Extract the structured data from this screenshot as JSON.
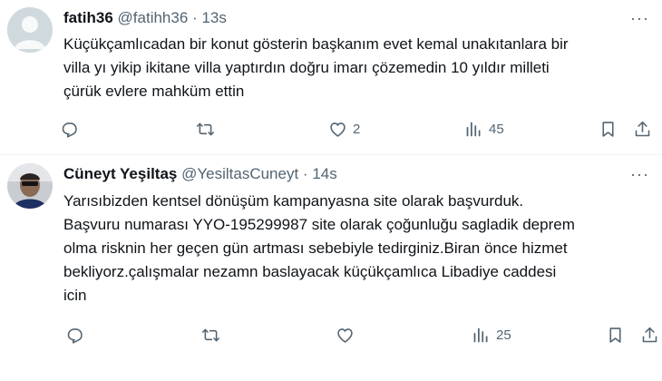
{
  "tweets": [
    {
      "display_name": "fatih36",
      "handle": "@fatihh36",
      "separator": "·",
      "time": "13s",
      "text_lines": [
        "Küçükçamlıcadan bir konut gösterin başkanım  evet kemal  unakıtanlara bir",
        "villa yı yikip ikitane villa yaptırdın doğru imarı çözemedin 10 yıldır  milleti",
        "çürük evlere mahküm ettin"
      ],
      "replies": "",
      "retweets": "",
      "likes": "2",
      "views": "45"
    },
    {
      "display_name": "Cüneyt Yeşiltaş",
      "handle": "@YesiltasCuneyt",
      "separator": "·",
      "time": "14s",
      "text_lines": [
        "Yarısıbizden kentsel dönüşüm kampanyasna site olarak başvurduk.",
        "Başvuru numarası YYO-195299987 site olarak çoğunluğu sagladik deprem",
        "olma risknin her geçen gün artması sebebiyle tedirginiz.Biran önce hizmet",
        "bekliyorz.çalışmalar nezamn baslayacak küçükçamlıca Libadiye caddesi",
        "icin"
      ],
      "replies": "",
      "retweets": "",
      "likes": "",
      "views": "25"
    }
  ],
  "more_glyph": "···",
  "icons": [
    "reply-icon",
    "retweet-icon",
    "like-icon",
    "views-icon",
    "bookmark-icon",
    "share-icon",
    "more-icon"
  ],
  "colors": {
    "text": "#0f1419",
    "secondary": "#536471",
    "divider": "#eff3f4",
    "avatar_placeholder": "#cfd9de"
  }
}
